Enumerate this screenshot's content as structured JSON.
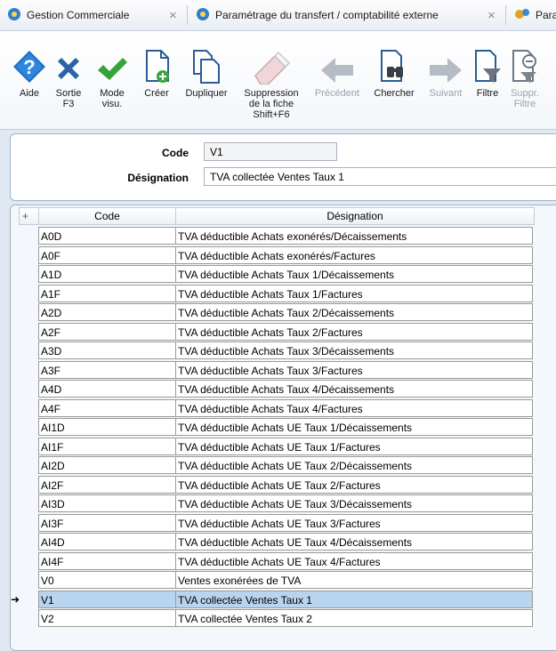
{
  "tabs": [
    {
      "label": "Gestion Commerciale"
    },
    {
      "label": "Paramétrage du transfert / comptabilité externe"
    },
    {
      "label": "Para"
    }
  ],
  "toolbar": [
    {
      "name": "aide",
      "label": "Aide",
      "icon": "help-icon"
    },
    {
      "name": "sortie",
      "label": "Sortie\nF3",
      "icon": "exit-x-icon"
    },
    {
      "name": "mode-visu",
      "label": "Mode\nvisu.",
      "icon": "check-icon"
    },
    {
      "name": "creer",
      "label": "Créer",
      "icon": "new-document-icon"
    },
    {
      "name": "dupliquer",
      "label": "Dupliquer",
      "icon": "duplicate-icon"
    },
    {
      "name": "suppression",
      "label": "Suppression\nde la fiche\nShift+F6",
      "icon": "eraser-icon"
    },
    {
      "name": "precedent",
      "label": "Précédent",
      "icon": "arrow-left-icon",
      "disabled": true
    },
    {
      "name": "chercher",
      "label": "Chercher",
      "icon": "binoculars-icon"
    },
    {
      "name": "suivant",
      "label": "Suivant",
      "icon": "arrow-right-icon",
      "disabled": true
    },
    {
      "name": "filtre",
      "label": "Filtre",
      "icon": "filter-icon"
    },
    {
      "name": "suppr-filtre",
      "label": "Suppr.\nFiltre",
      "icon": "remove-filter-icon",
      "disabled": true
    }
  ],
  "form": {
    "code_label": "Code",
    "code_value": "V1",
    "designation_label": "Désignation",
    "designation_value": "TVA collectée Ventes Taux 1"
  },
  "grid": {
    "add_icon": "+",
    "columns": [
      "Code",
      "Désignation"
    ],
    "selected_code": "V1",
    "selected_indicator": "➜",
    "rows": [
      {
        "code": "A0D",
        "designation": "TVA déductible Achats exonérés/Décaissements"
      },
      {
        "code": "A0F",
        "designation": "TVA déductible Achats exonérés/Factures"
      },
      {
        "code": "A1D",
        "designation": "TVA déductible Achats Taux 1/Décaissements"
      },
      {
        "code": "A1F",
        "designation": "TVA déductible Achats Taux 1/Factures"
      },
      {
        "code": "A2D",
        "designation": "TVA déductible Achats Taux 2/Décaissements"
      },
      {
        "code": "A2F",
        "designation": "TVA déductible Achats Taux 2/Factures"
      },
      {
        "code": "A3D",
        "designation": "TVA déductible Achats Taux 3/Décaissements"
      },
      {
        "code": "A3F",
        "designation": "TVA déductible Achats Taux 3/Factures"
      },
      {
        "code": "A4D",
        "designation": "TVA déductible Achats Taux 4/Décaissements"
      },
      {
        "code": "A4F",
        "designation": "TVA déductible Achats Taux 4/Factures"
      },
      {
        "code": "AI1D",
        "designation": "TVA déductible Achats UE Taux 1/Décaissements"
      },
      {
        "code": "AI1F",
        "designation": "TVA déductible Achats UE Taux 1/Factures"
      },
      {
        "code": "AI2D",
        "designation": "TVA déductible Achats UE Taux 2/Décaissements"
      },
      {
        "code": "AI2F",
        "designation": "TVA déductible Achats UE Taux 2/Factures"
      },
      {
        "code": "AI3D",
        "designation": "TVA déductible Achats UE Taux 3/Décaissements"
      },
      {
        "code": "AI3F",
        "designation": "TVA déductible Achats UE Taux 3/Factures"
      },
      {
        "code": "AI4D",
        "designation": "TVA déductible Achats UE Taux 4/Décaissements"
      },
      {
        "code": "AI4F",
        "designation": "TVA déductible Achats UE Taux 4/Factures"
      },
      {
        "code": "V0",
        "designation": "Ventes exonérées de TVA"
      },
      {
        "code": "V1",
        "designation": "TVA collectée Ventes Taux 1"
      },
      {
        "code": "V2",
        "designation": "TVA collectée Ventes Taux 2"
      }
    ]
  }
}
